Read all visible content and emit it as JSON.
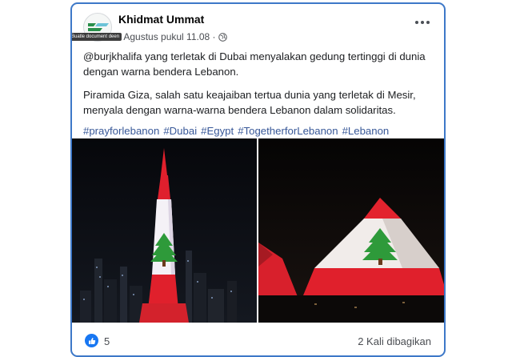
{
  "post": {
    "author": "Khidmat Ummat",
    "timestamp": "5 Agustus pukul 11.08 ·",
    "tooltip": "Buatle document deen",
    "privacy_icon": "globe-icon",
    "paragraph_1": "@burjkhalifa yang terletak di Dubai menyalakan gedung tertinggi di dunia dengan warna bendera Lebanon.",
    "paragraph_2": "Piramida Giza, salah satu keajaiban tertua dunia yang terletak di Mesir, menyala dengan warna-warna bendera Lebanon dalam solidaritas.",
    "hashtags": [
      "#prayforlebanon",
      "#Dubai",
      "#Egypt",
      "#TogetherforLebanon",
      "#Lebanon"
    ]
  },
  "photos": {
    "left": "Burj Khalifa lit with Lebanon flag",
    "right": "Pyramid of Giza lit with Lebanon flag"
  },
  "footer": {
    "like_icon": "thumbs-up-icon",
    "like_count": "5",
    "shares": "2 Kali dibagikan"
  },
  "colors": {
    "accent": "#1877f2",
    "link": "#385898",
    "card_border": "#3d78c8",
    "flag_red": "#e0202c",
    "cedar_green": "#2e9a3a"
  }
}
